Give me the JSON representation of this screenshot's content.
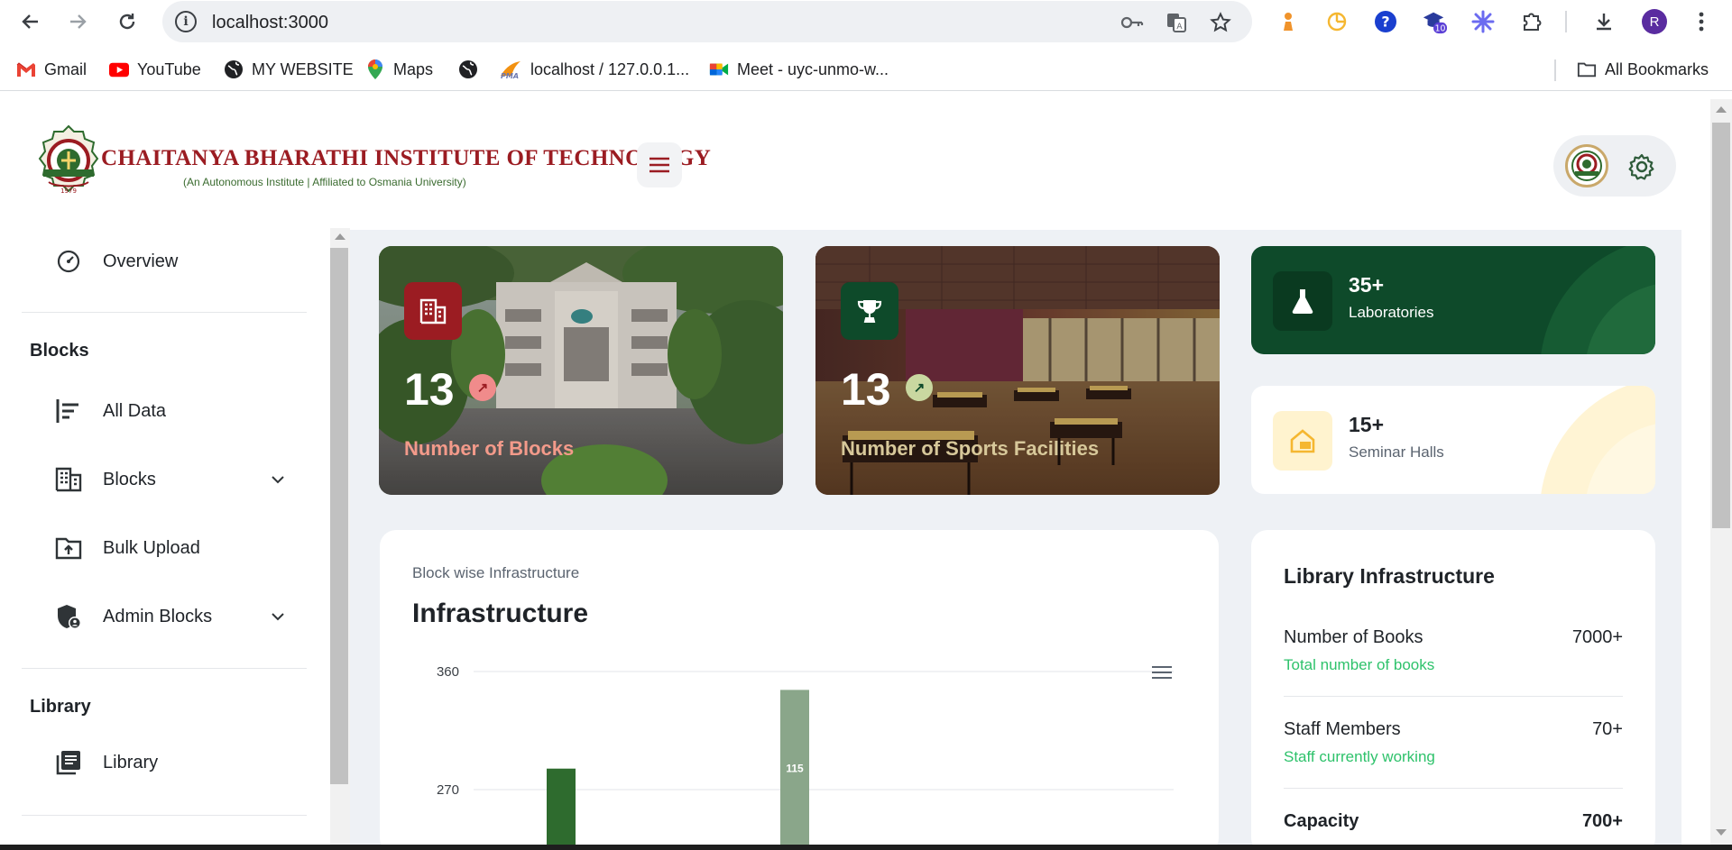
{
  "browser": {
    "url": "localhost:3000",
    "extension_badge": "10",
    "profile_initial": "R",
    "bookmarks": [
      {
        "label": "Gmail",
        "icon": "gmail-icon"
      },
      {
        "label": "YouTube",
        "icon": "youtube-icon"
      },
      {
        "label": "MY WEBSITE",
        "icon": "globe-icon"
      },
      {
        "label": "Maps",
        "icon": "maps-icon"
      },
      {
        "label": "",
        "icon": "globe-icon"
      },
      {
        "label": "localhost / 127.0.0.1...",
        "icon": "phpmyadmin-icon"
      },
      {
        "label": "Meet - uyc-unmo-w...",
        "icon": "meet-icon"
      }
    ],
    "all_bookmarks": "All Bookmarks"
  },
  "header": {
    "institute_name": "CHAITANYA BHARATHI INSTITUTE OF TECHNOLOGY",
    "institute_sub": "(An Autonomous Institute | Affiliated to Osmania University)"
  },
  "sidebar": {
    "overview": "Overview",
    "section_blocks": "Blocks",
    "all_data": "All Data",
    "blocks": "Blocks",
    "bulk_upload": "Bulk Upload",
    "admin_blocks": "Admin Blocks",
    "section_library": "Library",
    "library": "Library"
  },
  "cards": {
    "blocks": {
      "value": "13",
      "label": "Number of Blocks"
    },
    "sports": {
      "value": "13",
      "label": "Number of Sports Facilities"
    },
    "labs": {
      "value": "35+",
      "label": "Laboratories"
    },
    "seminar": {
      "value": "15+",
      "label": "Seminar Halls"
    }
  },
  "chart_card": {
    "subtitle": "Block wise Infrastructure",
    "title": "Infrastructure"
  },
  "chart_data": {
    "type": "bar",
    "y_ticks": [
      "360",
      "270"
    ],
    "ylim": [
      180,
      360
    ],
    "bars": [
      {
        "value": 286,
        "label": "",
        "color": "#2e6b2e"
      },
      {
        "value": 346,
        "label": "115",
        "color": "#8aa68a"
      }
    ]
  },
  "library": {
    "title": "Library Infrastructure",
    "rows": [
      {
        "name": "Number of Books",
        "value": "7000+",
        "desc": "Total number of books"
      },
      {
        "name": "Staff Members",
        "value": "70+",
        "desc": "Staff currently working"
      },
      {
        "name": "Capacity",
        "value": "700+",
        "desc": ""
      }
    ]
  },
  "colors": {
    "brand_red": "#9b1c22",
    "brand_green": "#0e4a2a",
    "accent_green": "#2ec26b",
    "content_bg": "#eef1f5"
  }
}
